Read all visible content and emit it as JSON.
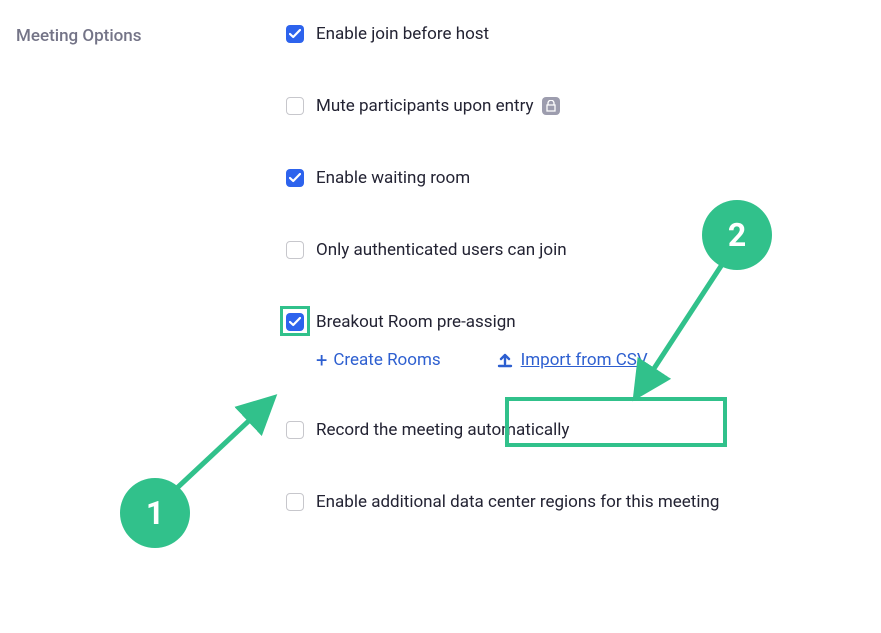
{
  "section": {
    "title": "Meeting Options"
  },
  "options": {
    "join_before_host": {
      "label": "Enable join before host",
      "checked": true
    },
    "mute_on_entry": {
      "label": "Mute participants upon entry",
      "checked": false,
      "locked": true
    },
    "waiting_room": {
      "label": "Enable waiting room",
      "checked": true
    },
    "authenticated_only": {
      "label": "Only authenticated users can join",
      "checked": false
    },
    "breakout_preassign": {
      "label": "Breakout Room pre-assign",
      "checked": true
    },
    "record_auto": {
      "label": "Record the meeting automatically",
      "checked": false
    },
    "data_center_regions": {
      "label": "Enable additional data center regions for this meeting",
      "checked": false
    }
  },
  "breakout_actions": {
    "create_rooms": "Create Rooms",
    "import_csv": "Import from CSV"
  },
  "annotations": {
    "badge1": "1",
    "badge2": "2"
  },
  "colors": {
    "accent": "#2d63ed",
    "highlight": "#31c18b",
    "link": "#2d5fd0"
  }
}
